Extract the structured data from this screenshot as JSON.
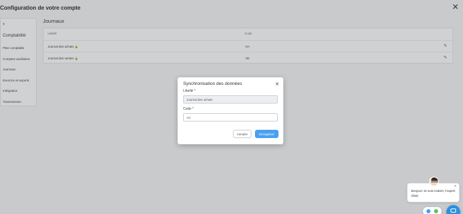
{
  "header": {
    "title": "Configuration de votre compte",
    "close_icon": "close-icon"
  },
  "sidebar": {
    "back_icon": "chevron-left-icon",
    "section": "Comptabilité",
    "items": [
      {
        "label": "Plan comptable"
      },
      {
        "label": "Comptes auxiliaires"
      },
      {
        "label": "Journaux"
      },
      {
        "label": "Exercice et exports"
      },
      {
        "label": "Intégration"
      },
      {
        "label": "Transmission"
      }
    ]
  },
  "main": {
    "title": "Journaux",
    "table": {
      "columns": [
        "Libellé",
        "Code"
      ],
      "rows": [
        {
          "label": "Journal des achats",
          "code": "HA",
          "icon": "lock-icon",
          "action": "pencil-icon"
        },
        {
          "label": "Journal des ventes",
          "code": "VE",
          "icon": "lock-icon",
          "action": "pencil-icon"
        }
      ]
    }
  },
  "modal": {
    "title": "Synchronisation des données",
    "close_icon": "close-icon",
    "libelle_label": "Libellé *",
    "libelle_value": "Journal des achats",
    "code_label": "Code *",
    "code_value": "AC",
    "cancel_label": "Annuler",
    "save_label": "Enregistrer"
  },
  "chat": {
    "message_line1": "Bonjour! Je suis Hubert, l'expert",
    "message_line2": "Obat.",
    "close_icon": "close-icon"
  },
  "colors": {
    "primary": "#4a9ff0",
    "launcher": "#2f8fe0"
  }
}
